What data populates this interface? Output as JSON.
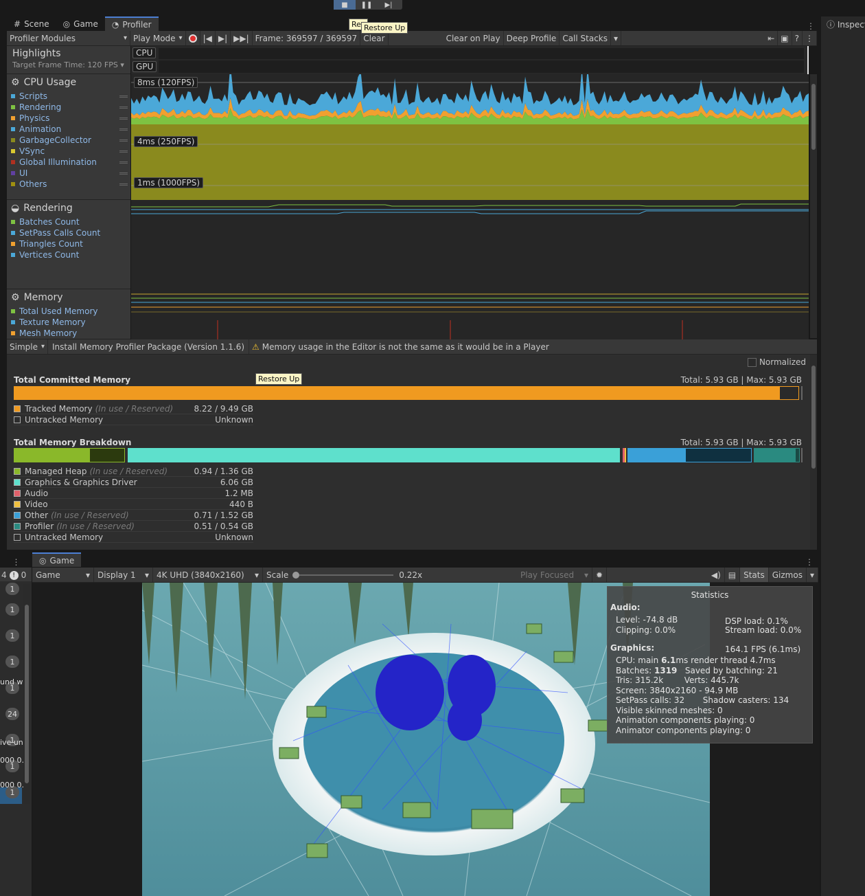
{
  "playbar": {
    "play": "■",
    "pause": "❚❚",
    "step": "▶|"
  },
  "tabs": {
    "scene": "Scene",
    "game": "Game",
    "profiler": "Profiler",
    "inspector": "Inspect"
  },
  "toolbar": {
    "modules": "Profiler Modules",
    "mode": "Play Mode",
    "frame": "Frame: 369597 / 369597",
    "clear": "Clear",
    "clear_on_play": "Clear on Play",
    "deep_profile": "Deep Profile",
    "call_stacks": "Call Stacks"
  },
  "tooltips": {
    "restore_up": "Restore Up",
    "restore_partial": "Res"
  },
  "highlights": {
    "title": "Highlights",
    "target": "Target Frame Time: 120 FPS",
    "cpu": "CPU",
    "gpu": "GPU"
  },
  "cpu_module": {
    "title": "CPU Usage",
    "items": [
      {
        "label": "Scripts",
        "color": "#4ba8d8"
      },
      {
        "label": "Rendering",
        "color": "#7ec242"
      },
      {
        "label": "Physics",
        "color": "#f0a030"
      },
      {
        "label": "Animation",
        "color": "#4ba8d8"
      },
      {
        "label": "GarbageCollector",
        "color": "#8a8a1e"
      },
      {
        "label": "VSync",
        "color": "#d8c830"
      },
      {
        "label": "Global Illumination",
        "color": "#b03020"
      },
      {
        "label": "UI",
        "color": "#6040a0"
      },
      {
        "label": "Others",
        "color": "#a09010"
      }
    ],
    "lines": [
      "8ms (120FPS)",
      "4ms (250FPS)",
      "1ms (1000FPS)"
    ]
  },
  "rendering_module": {
    "title": "Rendering",
    "items": [
      {
        "label": "Batches Count",
        "color": "#7ec242"
      },
      {
        "label": "SetPass Calls Count",
        "color": "#4ba8d8"
      },
      {
        "label": "Triangles Count",
        "color": "#f0a030"
      },
      {
        "label": "Vertices Count",
        "color": "#4ba8d8"
      }
    ]
  },
  "memory_module": {
    "title": "Memory",
    "items": [
      {
        "label": "Total Used Memory",
        "color": "#7ec242"
      },
      {
        "label": "Texture Memory",
        "color": "#4ba8d8"
      },
      {
        "label": "Mesh Memory",
        "color": "#f0a030"
      }
    ]
  },
  "memory_toolbar": {
    "view": "Simple",
    "install": "Install Memory Profiler Package (Version 1.1.6)",
    "warning": "Memory usage in the Editor is not the same as it would be in a Player",
    "normalized": "Normalized"
  },
  "committed": {
    "title": "Total Committed Memory",
    "total": "Total: 5.93 GB | Max: 5.93 GB",
    "fill": 0.976,
    "rows": [
      {
        "label": "Tracked Memory",
        "sub": "(In use / Reserved)",
        "value": "8.22 / 9.49 GB",
        "color": "#f09a20"
      },
      {
        "label": "Untracked Memory",
        "sub": "",
        "value": "Unknown",
        "color": "#2e2e2e"
      }
    ]
  },
  "breakdown": {
    "title": "Total Memory Breakdown",
    "total": "Total: 5.93 GB | Max: 5.93 GB",
    "rows": [
      {
        "label": "Managed Heap",
        "sub": "(In use / Reserved)",
        "value": "0.94 / 1.36 GB",
        "color": "#8ab82a"
      },
      {
        "label": "Graphics & Graphics Driver",
        "sub": "",
        "value": "6.06 GB",
        "color": "#5ee0cc"
      },
      {
        "label": "Audio",
        "sub": "",
        "value": "1.2 MB",
        "color": "#e0606a"
      },
      {
        "label": "Video",
        "sub": "",
        "value": "440 B",
        "color": "#f0c040"
      },
      {
        "label": "Other",
        "sub": "(In use / Reserved)",
        "value": "0.71 / 1.52 GB",
        "color": "#3aa0d8"
      },
      {
        "label": "Profiler",
        "sub": "(In use / Reserved)",
        "value": "0.51 / 0.54 GB",
        "color": "#2a8a80"
      },
      {
        "label": "Untracked Memory",
        "sub": "",
        "value": "Unknown",
        "color": "#2e2e2e"
      }
    ]
  },
  "game_tab": "Game",
  "game_toolbar": {
    "game": "Game",
    "display": "Display 1",
    "resolution": "4K UHD (3840x2160)",
    "scale_label": "Scale",
    "scale_value": "0.22x",
    "play_focused": "Play Focused",
    "stats": "Stats",
    "gizmos": "Gizmos"
  },
  "left_strip": {
    "count_a": "4",
    "count_b": "0",
    "badges": [
      "1",
      "1",
      "1",
      "1",
      "24",
      "1",
      "1",
      "1",
      "1"
    ],
    "snippets": [
      "und wi",
      "ive un",
      "000 0.",
      "000 0."
    ]
  },
  "statistics": {
    "title": "Statistics",
    "audio_hdr": "Audio:",
    "level": "Level: -74.8 dB",
    "clipping": "Clipping: 0.0%",
    "dsp": "DSP load: 0.1%",
    "stream": "Stream load: 0.0%",
    "graphics_hdr": "Graphics:",
    "fps": "164.1 FPS (6.1ms)",
    "cpu_pre": "CPU: main ",
    "cpu_main": "6.1",
    "cpu_post": "ms  render thread 4.7ms",
    "batches_pre": "Batches: ",
    "batches_val": "1319",
    "batches_post": "   Saved by batching: 21",
    "tris": "Tris: 315.2k        Verts: 445.7k",
    "screen": "Screen: 3840x2160 - 94.9 MB",
    "setpass": "SetPass calls: 32       Shadow casters: 134",
    "skinned": "Visible skinned meshes: 0",
    "anim": "Animation components playing: 0",
    "animator": "Animator components playing: 0"
  }
}
